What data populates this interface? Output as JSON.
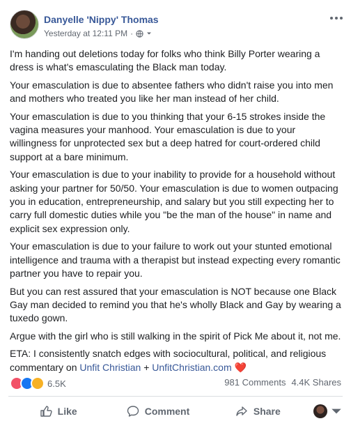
{
  "post": {
    "author": "Danyelle 'Nippy' Thomas",
    "timestamp": "Yesterday at 12:11 PM",
    "separator": "·",
    "paragraphs": [
      "I'm handing out deletions today for folks who think Billy Porter wearing a dress is what's emasculating the Black man today.",
      "Your emasculation is due to absentee fathers who didn't raise you into men and mothers who treated you like her man instead of her child.",
      "Your emasculation is due to you thinking that your 6-15 strokes inside the vagina measures your manhood. Your emasculation is due to your willingness for unprotected sex but a deep hatred for court-ordered child support at a bare minimum.",
      "Your emasculation is due to your inability to provide for a household without asking your partner for 50/50. Your emasculation is due to women outpacing you in education, entrepreneurship, and salary but you still expecting her to carry full domestic duties while you \"be the man of the house\" in name and explicit sex expression only.",
      "Your emasculation is due to your failure to work out your stunted emotional intelligence and trauma with a therapist but instead expecting every romantic partner you have to repair you.",
      "But you can rest assured that your emasculation is NOT because one Black Gay man decided to remind you that he's wholly Black and Gay by wearing a tuxedo gown.",
      "Argue with the girl who is still walking in the spirit of Pick Me about it, not me."
    ],
    "eta_text": "ETA: I consistently snatch edges with sociocultural, political, and religious commentary on",
    "eta_link1": "Unfit Christian",
    "eta_plus": "+",
    "eta_link2": "UnfitChristian.com",
    "eta_emoji": "❤️"
  },
  "stats": {
    "reactions_count": "6.5K",
    "reaction_types": [
      "love-icon",
      "like-icon",
      "haha-icon"
    ],
    "comments": "981 Comments",
    "shares": "4.4K Shares"
  },
  "actions": {
    "like": "Like",
    "comment": "Comment",
    "share": "Share"
  },
  "colors": {
    "link": "#385898",
    "text": "#1c1e21",
    "muted": "#616770",
    "heart": "#e0245e"
  }
}
